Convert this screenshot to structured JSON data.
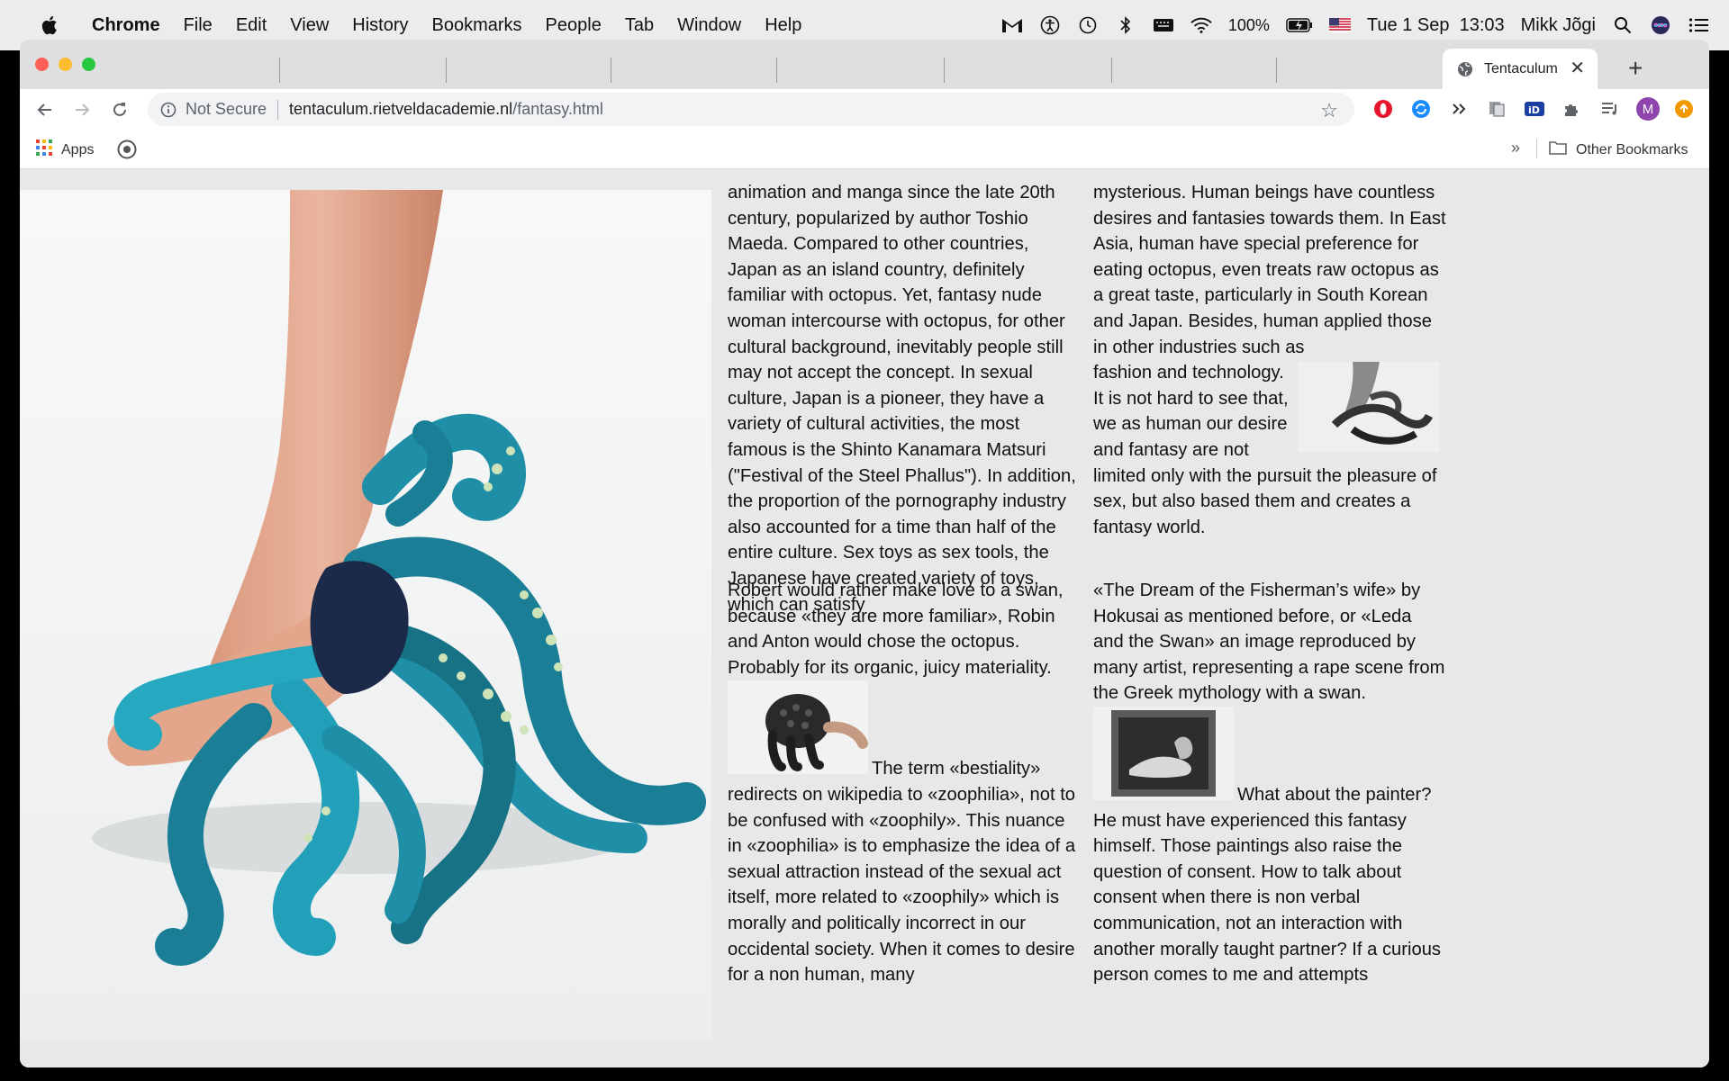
{
  "menubar": {
    "app_name": "Chrome",
    "items": [
      "File",
      "Edit",
      "View",
      "History",
      "Bookmarks",
      "People",
      "Tab",
      "Window",
      "Help"
    ],
    "battery": "100%",
    "datetime": "Tue 1 Sep  13:03",
    "user": "Mikk Jõgi"
  },
  "browser": {
    "active_tab_title": "Tentaculum",
    "address": {
      "security_label": "Not Secure",
      "host": "tentaculum.rietveldacademie.nl",
      "path": "/fantasy.html"
    },
    "profile_initial": "M",
    "bookmarks": {
      "apps_label": "Apps",
      "other_label": "Other Bookmarks",
      "more_glyph": "»"
    }
  },
  "article": {
    "col1_top": "animation and manga since the late 20th century, popularized by author Toshio Maeda. Compared to other countries, Japan as an island country, definitely familiar with octopus. Yet, fantasy nude woman intercourse with octopus, for other cultural background, inevitably people still may not accept the concept. In sexual culture, Japan is a pioneer, they have a variety of cultural activities, the most famous is the Shinto Kanamara Matsuri (\"Festival of the Steel Phallus\"). In addition, the proportion of the pornography industry also accounted for a time than half of the entire culture. Sex toys as sex tools, the Japanese have created variety of toys, which can satisfy",
    "col2_top_a": "mysterious. Human beings have countless desires and fantasies towards them. In East Asia, human have special preference for eating octopus, even treats raw octopus as a great taste, particularly in South Korean and Japan. Besides, human applied those in other industries such as",
    "col2_top_b": "fashion and technology.",
    "col2_top_c": "It is not hard to see that, we as human our desire and fantasy are not limited only with the pursuit the pleasure of sex, but also based them and creates a fantasy world.",
    "col1_bottom_a": "Robert would rather make love to a swan, because «they are more familiar», Robin and Anton would chose the octopus. Probably for its organic, juicy materiality.",
    "col1_bottom_b": "The term «bestiality» redirects on wikipedia to «zoophilia», not to be confused with «zoophily». This nuance in «zoophilia» is to emphasize the idea of a sexual attraction instead of the sexual act itself, more related to «zoophily» which is morally and politically incorrect in our occidental society. When it comes to desire for a non human, many",
    "col2_bottom_a": "«The Dream of the Fisherman’s wife» by Hokusai as mentioned before, or «Leda and the Swan» an image reproduced by many artist, representing a rape scene from the Greek mythology with a swan.",
    "col2_bottom_b": "What about the painter? He must have experienced this fantasy himself. Those paintings also raise the question of consent. How to talk about consent when there is non verbal communication, not an interaction with another morally taught partner? If a curious person comes to me and attempts"
  },
  "colors": {
    "page_bg": "#e8e8e8",
    "tentacle": "#1f8fa8",
    "close_red": "#fe5f57",
    "min_yellow": "#febc2e",
    "max_green": "#28c840"
  }
}
